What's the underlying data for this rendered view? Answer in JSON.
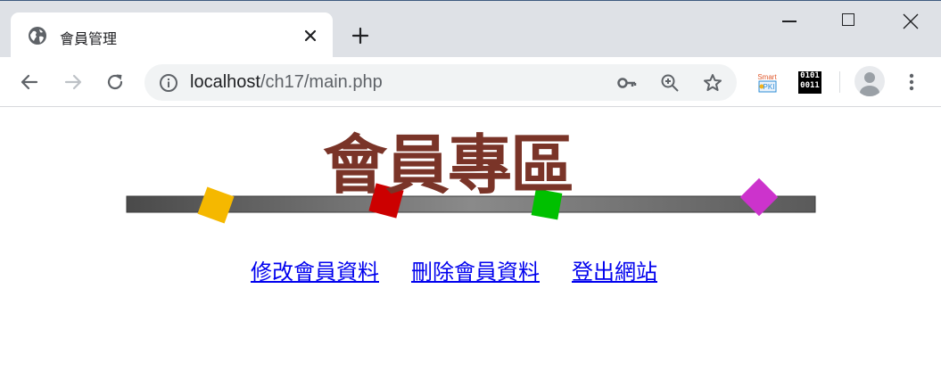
{
  "browser": {
    "tab": {
      "title": "會員管理",
      "favicon": "globe-icon"
    },
    "url": {
      "host": "localhost",
      "path": "/ch17/main.php"
    },
    "extensions": {
      "smart_pki": {
        "line1": "Smart",
        "line2": "PKI"
      },
      "binary": {
        "line1": "0101",
        "line2": "0011"
      }
    }
  },
  "page": {
    "banner_title": "會員專區",
    "links": [
      {
        "label": "修改會員資料"
      },
      {
        "label": "刪除會員資料"
      },
      {
        "label": "登出網站"
      }
    ]
  },
  "colors": {
    "banner_title": "#7a3428",
    "link": "#0000ee",
    "diamond_yellow": "#f5b800",
    "diamond_red": "#cc0000",
    "diamond_green": "#00c000",
    "diamond_magenta": "#cc33cc"
  }
}
